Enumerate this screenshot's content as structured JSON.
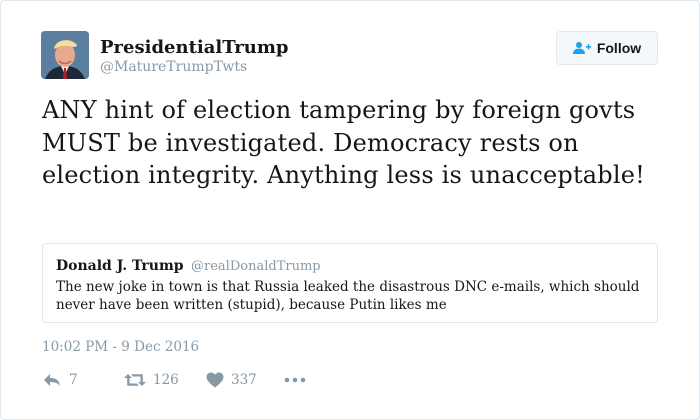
{
  "tweet": {
    "author_name": "PresidentialTrump",
    "author_handle": "@MatureTrumpTwts",
    "follow_label": "Follow",
    "text": "ANY hint of election tampering by foreign govts MUST be investigated. Democracy rests on election integrity. Anything less is unacceptable!",
    "timestamp": "10:02 PM - 9 Dec 2016",
    "quoted": {
      "author_name": "Donald J. Trump",
      "author_handle": "@realDonaldTrump",
      "text": "The new joke in town is that Russia leaked the disastrous DNC e-mails, which should never have been written (stupid), because Putin likes me"
    },
    "stats": {
      "replies": "7",
      "retweets": "126",
      "likes": "337"
    }
  },
  "icons": {
    "reply": "reply-icon",
    "retweet": "retweet-icon",
    "like": "heart-icon",
    "more": "more-icon",
    "follow": "add-user-icon"
  },
  "colors": {
    "text": "#14171a",
    "muted": "#8899a6",
    "border": "#e1e8ed",
    "follow_icon": "#1da1f2"
  }
}
